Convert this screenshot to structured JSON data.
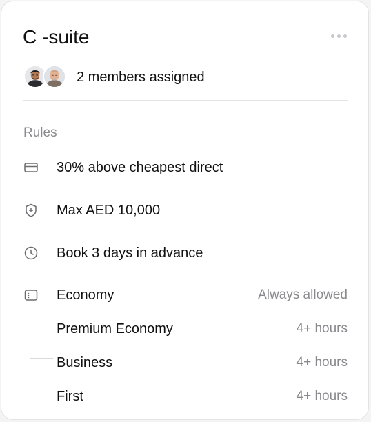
{
  "card": {
    "title": "C -suite",
    "more_icon": "more-horizontal-icon",
    "members": {
      "avatars": [
        "avatar-person-1",
        "avatar-person-2"
      ],
      "text": "2 members assigned"
    },
    "rules_label": "Rules",
    "rules": [
      {
        "icon": "credit-card-icon",
        "text": "30% above cheapest direct"
      },
      {
        "icon": "shield-plus-icon",
        "text": "Max AED 10,000"
      },
      {
        "icon": "clock-icon",
        "text": "Book 3 days in advance"
      }
    ],
    "cabin_icon": "seat-class-icon",
    "cabins": [
      {
        "name": "Economy",
        "value": "Always allowed"
      },
      {
        "name": "Premium Economy",
        "value": "4+ hours"
      },
      {
        "name": "Business",
        "value": "4+ hours"
      },
      {
        "name": "First",
        "value": "4+ hours"
      }
    ]
  },
  "colors": {
    "text": "#111111",
    "muted": "#8a8a8e",
    "border": "#e4e4e7",
    "icon": "#6b6b70"
  }
}
